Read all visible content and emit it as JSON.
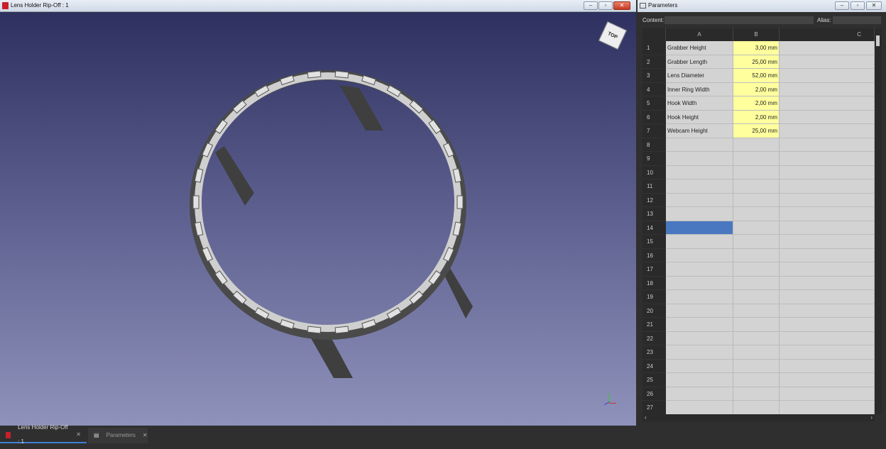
{
  "document_window": {
    "title": "Lens Holder Rip-Off : 1",
    "buttons": [
      "minimize",
      "restore",
      "close"
    ]
  },
  "navigation_cube": {
    "face_label": "TOP"
  },
  "parameters_window": {
    "title": "Parameters",
    "content_label": "Content:",
    "content_value": "",
    "alias_label": "Alias:",
    "alias_value": "",
    "columns": [
      "A",
      "B",
      "C"
    ],
    "rows": [
      {
        "n": "1",
        "a": "Grabber Height",
        "b": "3,00 mm"
      },
      {
        "n": "2",
        "a": "Grabber Length",
        "b": "25,00 mm"
      },
      {
        "n": "3",
        "a": "Lens Diameter",
        "b": "52,00 mm"
      },
      {
        "n": "4",
        "a": "Inner Ring Width",
        "b": "2,00 mm"
      },
      {
        "n": "5",
        "a": "Hook Width",
        "b": "2,00 mm"
      },
      {
        "n": "6",
        "a": "Hook Height",
        "b": "2,00 mm"
      },
      {
        "n": "7",
        "a": "Webcam Height",
        "b": "25,00 mm"
      },
      {
        "n": "8",
        "a": "",
        "b": ""
      },
      {
        "n": "9",
        "a": "",
        "b": ""
      },
      {
        "n": "10",
        "a": "",
        "b": ""
      },
      {
        "n": "11",
        "a": "",
        "b": ""
      },
      {
        "n": "12",
        "a": "",
        "b": ""
      },
      {
        "n": "13",
        "a": "",
        "b": ""
      },
      {
        "n": "14",
        "a": "",
        "b": ""
      },
      {
        "n": "15",
        "a": "",
        "b": ""
      },
      {
        "n": "16",
        "a": "",
        "b": ""
      },
      {
        "n": "17",
        "a": "",
        "b": ""
      },
      {
        "n": "18",
        "a": "",
        "b": ""
      },
      {
        "n": "19",
        "a": "",
        "b": ""
      },
      {
        "n": "20",
        "a": "",
        "b": ""
      },
      {
        "n": "21",
        "a": "",
        "b": ""
      },
      {
        "n": "22",
        "a": "",
        "b": ""
      },
      {
        "n": "23",
        "a": "",
        "b": ""
      },
      {
        "n": "24",
        "a": "",
        "b": ""
      },
      {
        "n": "25",
        "a": "",
        "b": ""
      },
      {
        "n": "26",
        "a": "",
        "b": ""
      },
      {
        "n": "27",
        "a": "",
        "b": ""
      }
    ],
    "selected_cell": "A14"
  },
  "tabs": [
    {
      "label": "Lens Holder Rip-Off : 1",
      "active": true
    },
    {
      "label": "Parameters",
      "active": false
    }
  ],
  "colors": {
    "filled_cell": "#ffff9e",
    "selected_cell": "#4a78c0",
    "active_tab_underline": "#3d7fd6"
  }
}
